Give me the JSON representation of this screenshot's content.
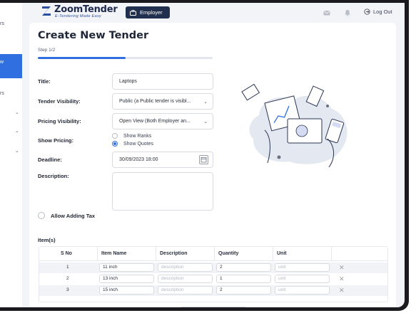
{
  "app": {
    "logo_name": "ZoomTender",
    "logo_tagline": "E-Tendering Made Easy",
    "role_button": "Employer",
    "logout": "Log Out",
    "accent": "#2f6fe0",
    "header_dark": "#22304f"
  },
  "sidebar": {
    "items": [
      {
        "label": "rs"
      },
      {
        "label": "w"
      },
      {
        "label": "rs"
      }
    ]
  },
  "form": {
    "title": "Create New Tender",
    "step": "Step 1/2",
    "progress": 0.5,
    "title_label": "Title:",
    "title_value": "Laptops",
    "visibility_label": "Tender Visibility:",
    "visibility_value": "Public (a Public tender is visibl...",
    "pricing_label": "Pricing Visibility:",
    "pricing_value": "Open View (Both Employer an...",
    "show_pricing_label": "Show Pricing:",
    "show_pricing_options": [
      "Show Ranks",
      "Show Quotes"
    ],
    "show_pricing_selected": "Show Quotes",
    "deadline_label": "Deadline:",
    "deadline_value": "30/09/2023 18:00",
    "description_label": "Description:",
    "allow_tax_label": "Allow Adding Tax"
  },
  "items": {
    "label": "Item(s)",
    "columns": [
      "S No",
      "Item Name",
      "Description",
      "Quantity",
      "Unit"
    ],
    "description_placeholder": "description",
    "unit_placeholder": "unit",
    "rows": [
      {
        "sno": "1",
        "name": "11 inch",
        "quantity": "2"
      },
      {
        "sno": "2",
        "name": "13 inch",
        "quantity": "1"
      },
      {
        "sno": "3",
        "name": "15 inch",
        "quantity": "2"
      }
    ]
  }
}
